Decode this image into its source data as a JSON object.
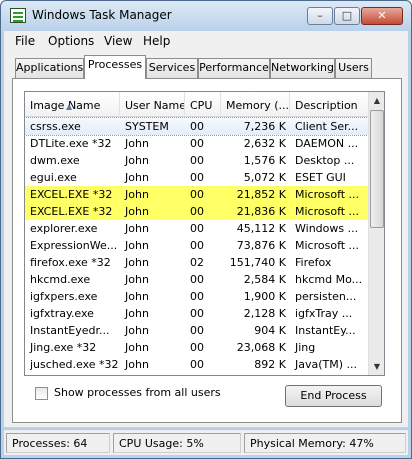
{
  "window": {
    "title": "Windows Task Manager",
    "minimize": "–",
    "maximize": "□",
    "close": "✕"
  },
  "menu": [
    "File",
    "Options",
    "View",
    "Help"
  ],
  "tabs": [
    "Applications",
    "Processes",
    "Services",
    "Performance",
    "Networking",
    "Users"
  ],
  "active_tab": "Processes",
  "columns": [
    "Image Name",
    "User Name",
    "CPU",
    "Memory (...",
    "Description"
  ],
  "rows": [
    {
      "name": "csrss.exe",
      "user": "SYSTEM",
      "cpu": "00",
      "mem": "7,236 K",
      "desc": "Client Ser..."
    },
    {
      "name": "DTLite.exe *32",
      "user": "John",
      "cpu": "00",
      "mem": "2,632 K",
      "desc": "DAEMON ..."
    },
    {
      "name": "dwm.exe",
      "user": "John",
      "cpu": "00",
      "mem": "1,576 K",
      "desc": "Desktop ..."
    },
    {
      "name": "egui.exe",
      "user": "John",
      "cpu": "00",
      "mem": "5,072 K",
      "desc": "ESET GUI"
    },
    {
      "name": "EXCEL.EXE *32",
      "user": "John",
      "cpu": "00",
      "mem": "21,852 K",
      "desc": "Microsoft ..."
    },
    {
      "name": "EXCEL.EXE *32",
      "user": "John",
      "cpu": "00",
      "mem": "21,836 K",
      "desc": "Microsoft ..."
    },
    {
      "name": "explorer.exe",
      "user": "John",
      "cpu": "00",
      "mem": "45,112 K",
      "desc": "Windows ..."
    },
    {
      "name": "ExpressionWe...",
      "user": "John",
      "cpu": "00",
      "mem": "73,876 K",
      "desc": "Microsoft ..."
    },
    {
      "name": "firefox.exe *32",
      "user": "John",
      "cpu": "02",
      "mem": "151,740 K",
      "desc": "Firefox"
    },
    {
      "name": "hkcmd.exe",
      "user": "John",
      "cpu": "00",
      "mem": "2,584 K",
      "desc": "hkcmd Mo..."
    },
    {
      "name": "igfxpers.exe",
      "user": "John",
      "cpu": "00",
      "mem": "1,900 K",
      "desc": "persisten..."
    },
    {
      "name": "igfxtray.exe",
      "user": "John",
      "cpu": "00",
      "mem": "2,128 K",
      "desc": "igfxTray ..."
    },
    {
      "name": "InstantEyedr...",
      "user": "John",
      "cpu": "00",
      "mem": "904 K",
      "desc": "InstantEy..."
    },
    {
      "name": "Jing.exe *32",
      "user": "John",
      "cpu": "00",
      "mem": "23,068 K",
      "desc": "Jing"
    },
    {
      "name": "jusched.exe *32",
      "user": "John",
      "cpu": "00",
      "mem": "892 K",
      "desc": "Java(TM) ..."
    }
  ],
  "highlighted_rows": [
    "EXCEL.EXE *32"
  ],
  "highlight_color": "#ffff66",
  "show_all_label": "Show processes from all users",
  "end_process_label": "End Process",
  "status": {
    "processes": "Processes: 64",
    "cpu": "CPU Usage: 5%",
    "memory": "Physical Memory: 47%"
  }
}
